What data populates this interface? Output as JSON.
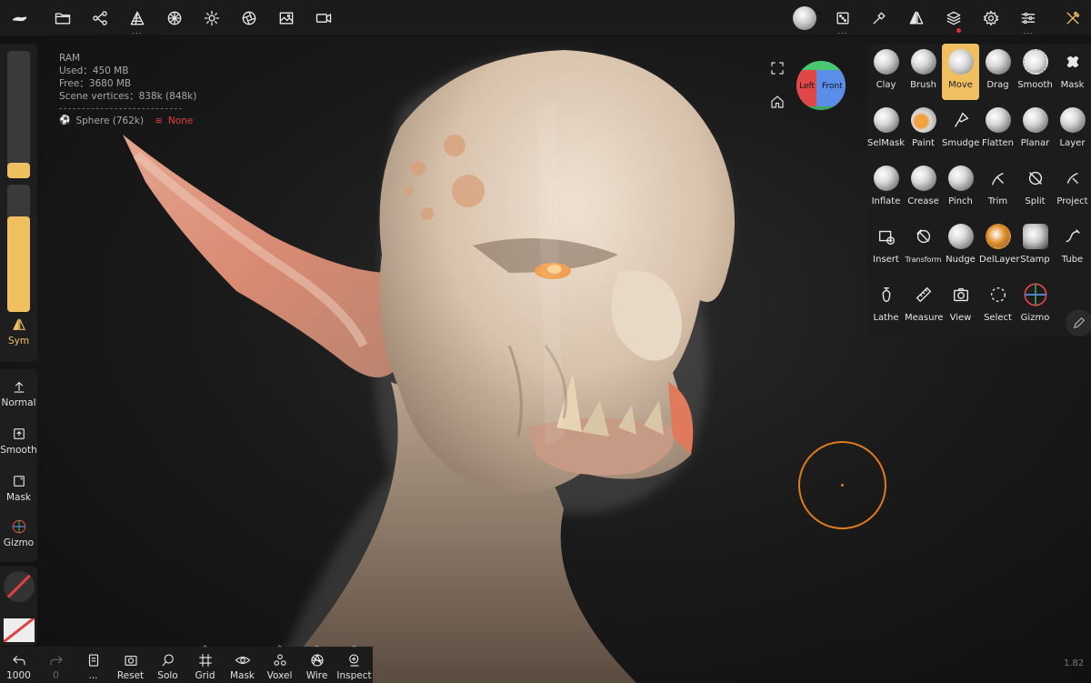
{
  "info": {
    "ram_label": "RAM",
    "used": "Used：450 MB",
    "free": "Free：3680 MB",
    "scene_vertices": "Scene vertices：838k (848k)",
    "mesh_name": "Sphere (762k)",
    "layer_status": "None"
  },
  "topbar": {
    "icons": [
      "logo-icon",
      "folder-icon",
      "scene-graph-icon",
      "topology-icon",
      "material-sphere-icon",
      "light-icon",
      "aperture-icon",
      "image-icon",
      "video-icon",
      "matcap-icon",
      "dice-icon",
      "hammer-icon",
      "symmetry-icon",
      "layers-icon",
      "gear-icon",
      "sliders-icon",
      "tools-icon"
    ]
  },
  "viewcube": {
    "left_label": "Left",
    "front_label": "Front"
  },
  "left_panel": {
    "sym_label": "Sym",
    "radius_slider": 0.12,
    "intensity_slider": 0.75,
    "items": [
      {
        "label": "Normal"
      },
      {
        "label": "Smooth"
      },
      {
        "label": "Mask"
      },
      {
        "label": "Gizmo"
      }
    ]
  },
  "tools": [
    {
      "label": "Clay"
    },
    {
      "label": "Brush"
    },
    {
      "label": "Move"
    },
    {
      "label": "Drag"
    },
    {
      "label": "Smooth"
    },
    {
      "label": "Mask"
    },
    {
      "label": "SelMask"
    },
    {
      "label": "Paint"
    },
    {
      "label": "Smudge"
    },
    {
      "label": "Flatten"
    },
    {
      "label": "Planar"
    },
    {
      "label": "Layer"
    },
    {
      "label": "Inflate"
    },
    {
      "label": "Crease"
    },
    {
      "label": "Pinch"
    },
    {
      "label": "Trim"
    },
    {
      "label": "Split"
    },
    {
      "label": "Project"
    },
    {
      "label": "Insert"
    },
    {
      "label": "Transform"
    },
    {
      "label": "Nudge"
    },
    {
      "label": "DelLayer"
    },
    {
      "label": "Stamp"
    },
    {
      "label": "Tube"
    },
    {
      "label": "Lathe"
    },
    {
      "label": "Measure"
    },
    {
      "label": "View"
    },
    {
      "label": "Select"
    },
    {
      "label": "Gizmo"
    }
  ],
  "active_tool": "Move",
  "bottombar": {
    "undo_count": "1000",
    "redo_count": "0",
    "more": "...",
    "reset": "Reset",
    "solo": "Solo",
    "grid": "Grid",
    "mask": "Mask",
    "voxel": "Voxel",
    "wire": "Wire",
    "inspect": "Inspect"
  },
  "version": "1.82",
  "colors": {
    "accent": "#f0c060",
    "brush_ring": "#e07a1e",
    "warning": "#e0403a"
  }
}
